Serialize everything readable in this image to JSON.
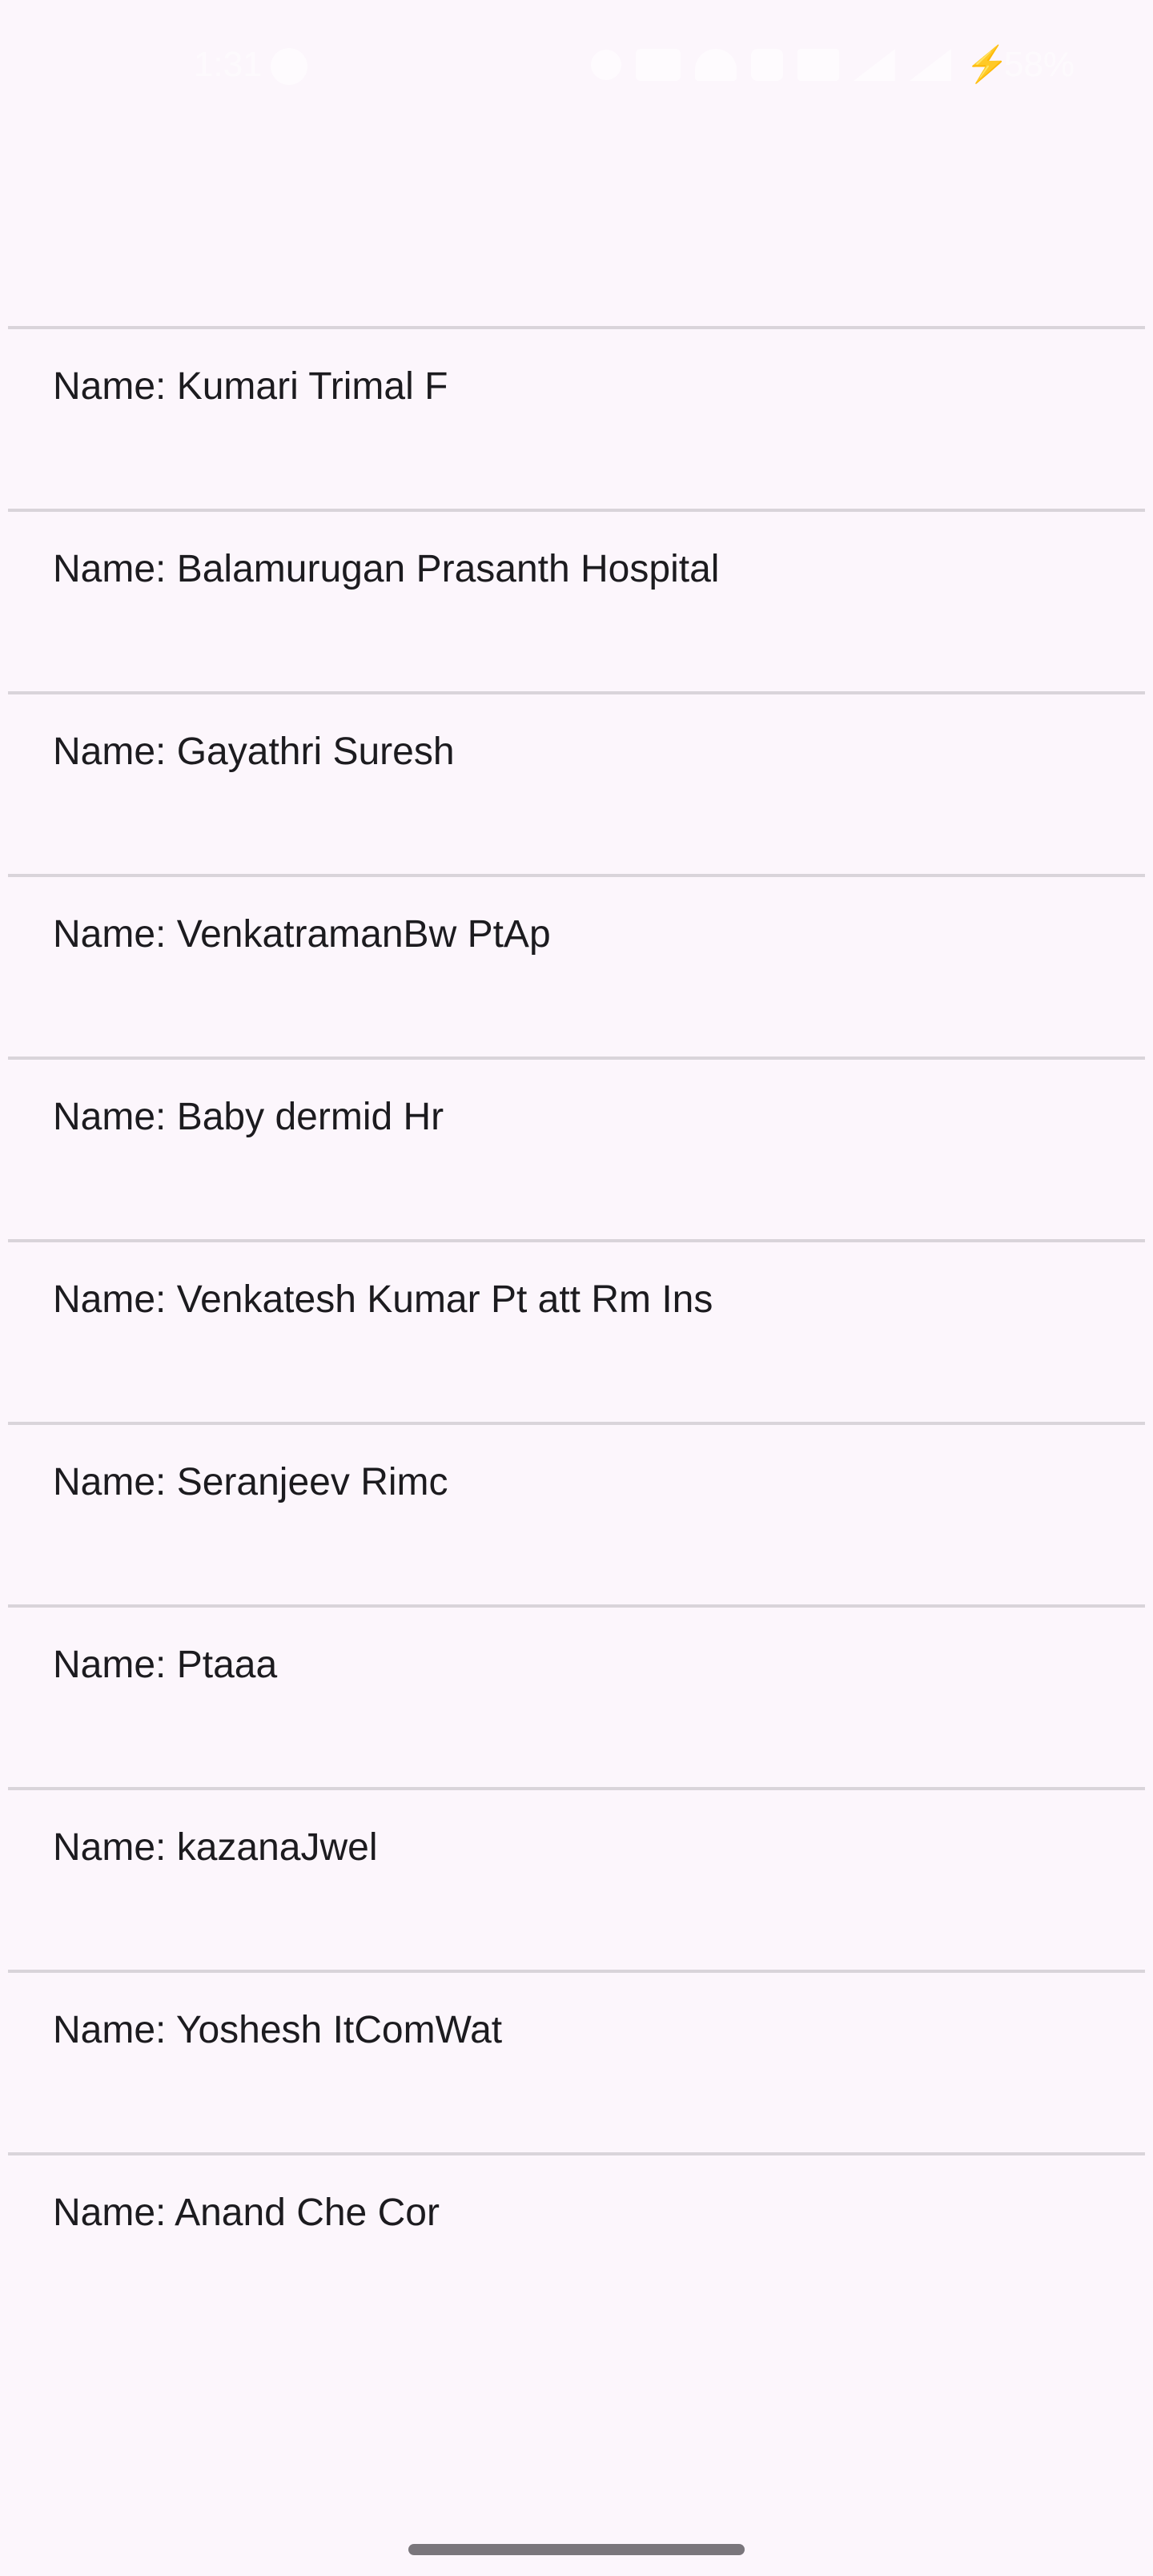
{
  "status_bar": {
    "time": "1:31",
    "battery_percent": "58%",
    "battery_bolt_color": "#1aa71a",
    "icons": [
      "notification-icon",
      "alarm-icon",
      "data-speed-icon",
      "wifi-icon",
      "call-icon",
      "volume-icon",
      "signal-icon",
      "signal-icon",
      "charging-icon"
    ]
  },
  "list": {
    "items": [
      {
        "label": "Name: Kumari Trimal F"
      },
      {
        "label": "Name: Balamurugan Prasanth Hospital"
      },
      {
        "label": "Name: Gayathri Suresh"
      },
      {
        "label": "Name: VenkatramanBw PtAp"
      },
      {
        "label": "Name: Baby dermid Hr"
      },
      {
        "label": "Name: Venkatesh Kumar Pt att Rm Ins"
      },
      {
        "label": "Name: Seranjeev Rimc"
      },
      {
        "label": "Name: Ptaaa"
      },
      {
        "label": "Name: kazanaJwel"
      },
      {
        "label": "Name: Yoshesh ItComWat"
      },
      {
        "label": "Name: Anand Che Cor"
      }
    ]
  },
  "colors": {
    "background": "#fcf6fc",
    "divider": "#d9d4da",
    "text": "#1c1b1f"
  }
}
